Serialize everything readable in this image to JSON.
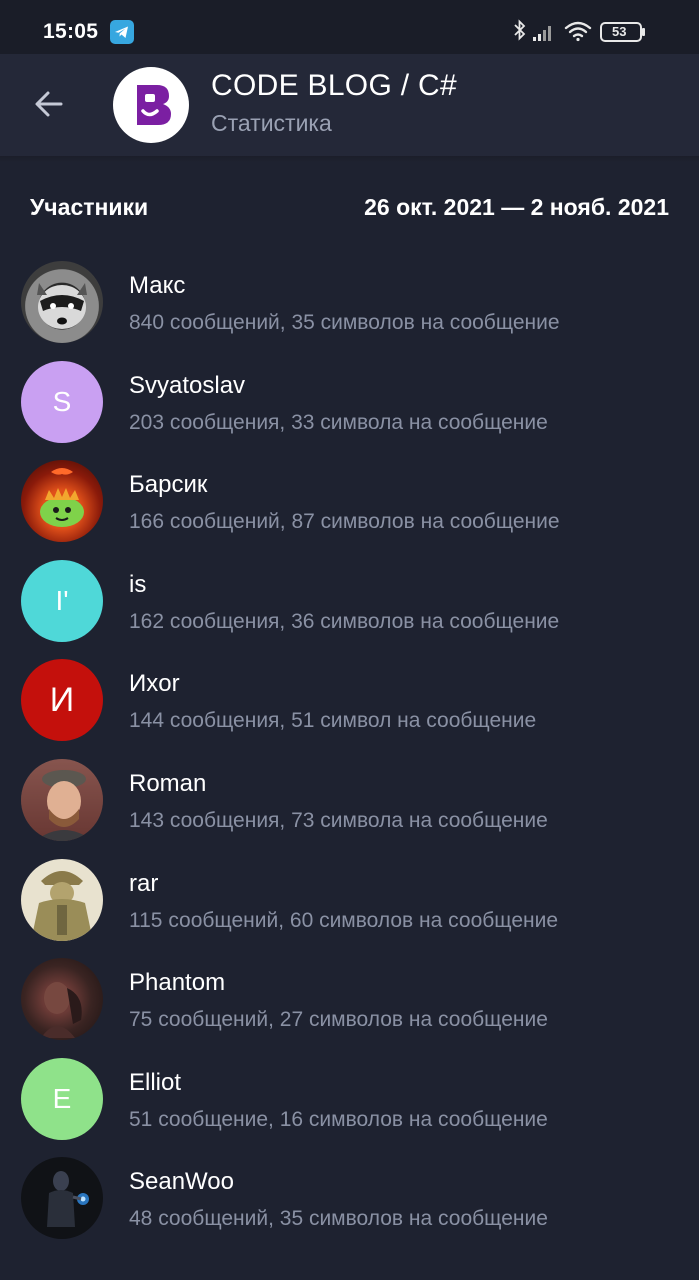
{
  "status_bar": {
    "time": "15:05",
    "battery": "53",
    "icons": [
      "telegram-icon",
      "bluetooth-icon",
      "signal-icon",
      "wifi-icon",
      "battery-icon"
    ]
  },
  "header": {
    "title": "CODE BLOG / C#",
    "subtitle": "Статистика"
  },
  "section": {
    "title": "Участники",
    "date_range": "26 окт. 2021 — 2 нояб. 2021"
  },
  "members": [
    {
      "name": "Макс",
      "stats": "840 сообщений, 35 символов на сообщение",
      "initial": "",
      "avatar_color": "#5a5a5a"
    },
    {
      "name": "Svyatoslav",
      "stats": "203 сообщения, 33 символа на сообщение",
      "initial": "S",
      "avatar_color": "#c9a0f2"
    },
    {
      "name": "Барсик",
      "stats": "166 сообщений, 87 символов на сообщение",
      "initial": "",
      "avatar_color": "#8a1a0a"
    },
    {
      "name": "is",
      "stats": "162 сообщения, 36 символов на сообщение",
      "initial": "I'",
      "avatar_color": "#4fd8d8"
    },
    {
      "name": "Ихor",
      "stats": "144 сообщения, 51 символ на сообщение",
      "initial": "И",
      "avatar_color": "#c4100c"
    },
    {
      "name": "Roman",
      "stats": "143 сообщения, 73 символа на сообщение",
      "initial": "",
      "avatar_color": "#6b6258"
    },
    {
      "name": "rar",
      "stats": "115 сообщений, 60 символов на сообщение",
      "initial": "",
      "avatar_color": "#a39a6a"
    },
    {
      "name": "Phantom",
      "stats": "75 сообщений, 27 символов на сообщение",
      "initial": "",
      "avatar_color": "#3a2422"
    },
    {
      "name": "Elliot",
      "stats": "51 сообщение, 16 символов на сообщение",
      "initial": "E",
      "avatar_color": "#8fe28a"
    },
    {
      "name": "SeanWoo",
      "stats": "48 сообщений, 35 символов на сообщение",
      "initial": "",
      "avatar_color": "#101216"
    }
  ],
  "colors": {
    "background": "#1e2230",
    "header": "#242838",
    "secondary_text": "#8a91a4",
    "brand": "#7b1fa2"
  }
}
